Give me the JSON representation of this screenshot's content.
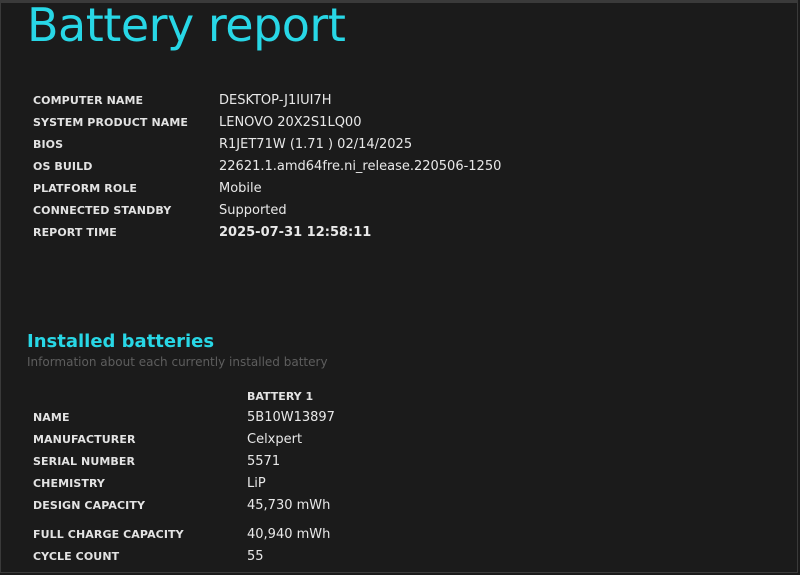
{
  "title": "Battery report",
  "system": {
    "rows": [
      {
        "key": "COMPUTER NAME",
        "value": "DESKTOP-J1IUI7H"
      },
      {
        "key": "SYSTEM PRODUCT NAME",
        "value": "LENOVO 20X2S1LQ00"
      },
      {
        "key": "BIOS",
        "value": "R1JET71W (1.71 ) 02/14/2025"
      },
      {
        "key": "OS BUILD",
        "value": "22621.1.amd64fre.ni_release.220506-1250"
      },
      {
        "key": "PLATFORM ROLE",
        "value": "Mobile"
      },
      {
        "key": "CONNECTED STANDBY",
        "value": "Supported"
      },
      {
        "key": "REPORT TIME",
        "value": "2025-07-31  12:58:11"
      }
    ]
  },
  "installed_batteries": {
    "title": "Installed batteries",
    "subtitle": "Information about each currently installed battery",
    "battery_header": "BATTERY 1",
    "rows": [
      {
        "key": "NAME",
        "value": "5B10W13897"
      },
      {
        "key": "MANUFACTURER",
        "value": "Celxpert"
      },
      {
        "key": "SERIAL NUMBER",
        "value": "5571"
      },
      {
        "key": "CHEMISTRY",
        "value": "LiP"
      },
      {
        "key": "DESIGN CAPACITY",
        "value": "45,730 mWh"
      },
      {
        "key": "FULL CHARGE CAPACITY",
        "value": "40,940 mWh"
      },
      {
        "key": "CYCLE COUNT",
        "value": "55"
      }
    ]
  },
  "colors": {
    "accent": "#28d7e6",
    "background": "#1b1b1b",
    "text": "#e6e6e6",
    "muted": "#5e5e5e"
  }
}
